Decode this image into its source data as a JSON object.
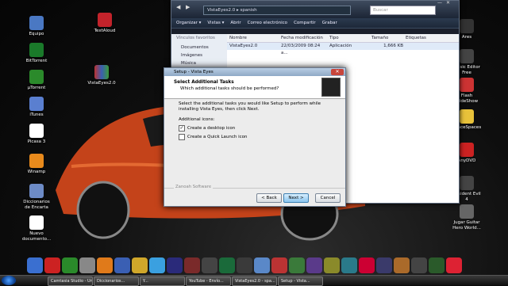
{
  "desktop": {
    "icons_left": [
      {
        "label": "Equipo",
        "color": "#4a78c3"
      },
      {
        "label": "BitTorrent",
        "color": "#1a7a2a"
      },
      {
        "label": "µTorrent",
        "color": "#2b8a2b"
      },
      {
        "label": "iTunes",
        "color": "#5a7fd0"
      },
      {
        "label": "Picasa 3",
        "color": "#ffffff"
      },
      {
        "label": "Winamp",
        "color": "#e88a1c"
      },
      {
        "label": "Diccionarios de Encarta",
        "color": "#6d8bc6"
      },
      {
        "label": "Nuevo documento...",
        "color": "#ffffff"
      }
    ],
    "icon_textaloud": "TextAloud",
    "icon_winrar": "VistaEyes2.0",
    "icons_right": [
      {
        "label": "Ares",
        "color": "#333"
      },
      {
        "label": "Music Editor Free",
        "color": "#444"
      },
      {
        "label": "Flash SlideShow",
        "color": "#c33"
      },
      {
        "label": "SpaceSpaces",
        "color": "#e8c23a"
      },
      {
        "label": "AnyDVD",
        "color": "#c22"
      },
      {
        "label": "Resident Evil 4",
        "color": "#444"
      },
      {
        "label": "Jugar Guitar Hero World...",
        "color": "#666"
      }
    ]
  },
  "explorer": {
    "path": "VistaEyes2.0 ▸ spanish",
    "search_placeholder": "Buscar",
    "toolbar": [
      "Organizar ▾",
      "Vistas ▾",
      "Abrir",
      "Correo electrónico",
      "Compartir",
      "Grabar"
    ],
    "sidebar_title": "Vínculos favoritos",
    "sidebar_items": [
      "Documentos",
      "Imágenes",
      "Música"
    ],
    "columns": [
      "Nombre",
      "Fecha modificación",
      "Tipo",
      "Tamaño",
      "Etiquetas"
    ],
    "files": [
      {
        "name": "VistaEyes2.0",
        "date": "22/03/2009 08:24 a...",
        "type": "Aplicación",
        "size": "1,666 KB"
      }
    ]
  },
  "setup": {
    "title": "Setup - Vista Eyes",
    "heading": "Select Additional Tasks",
    "subheading": "Which additional tasks should be performed?",
    "intro": "Select the additional tasks you would like Setup to perform while installing Vista Eyes, then click Next.",
    "group_label": "Additional icons:",
    "options": [
      {
        "label": "Create a desktop icon",
        "checked": "✓"
      },
      {
        "label": "Create a Quick Launch icon",
        "checked": ""
      }
    ],
    "brand": "Zanoah Software",
    "back": "< Back",
    "next": "Next >",
    "cancel": "Cancel"
  },
  "taskbar": {
    "tasks": [
      "Camtasia Studio - Un...",
      "Diccionarios...",
      "Y...",
      "YouTube - Envío...",
      "VistaEyes2.0 - spa...",
      "Setup - Vista..."
    ]
  }
}
